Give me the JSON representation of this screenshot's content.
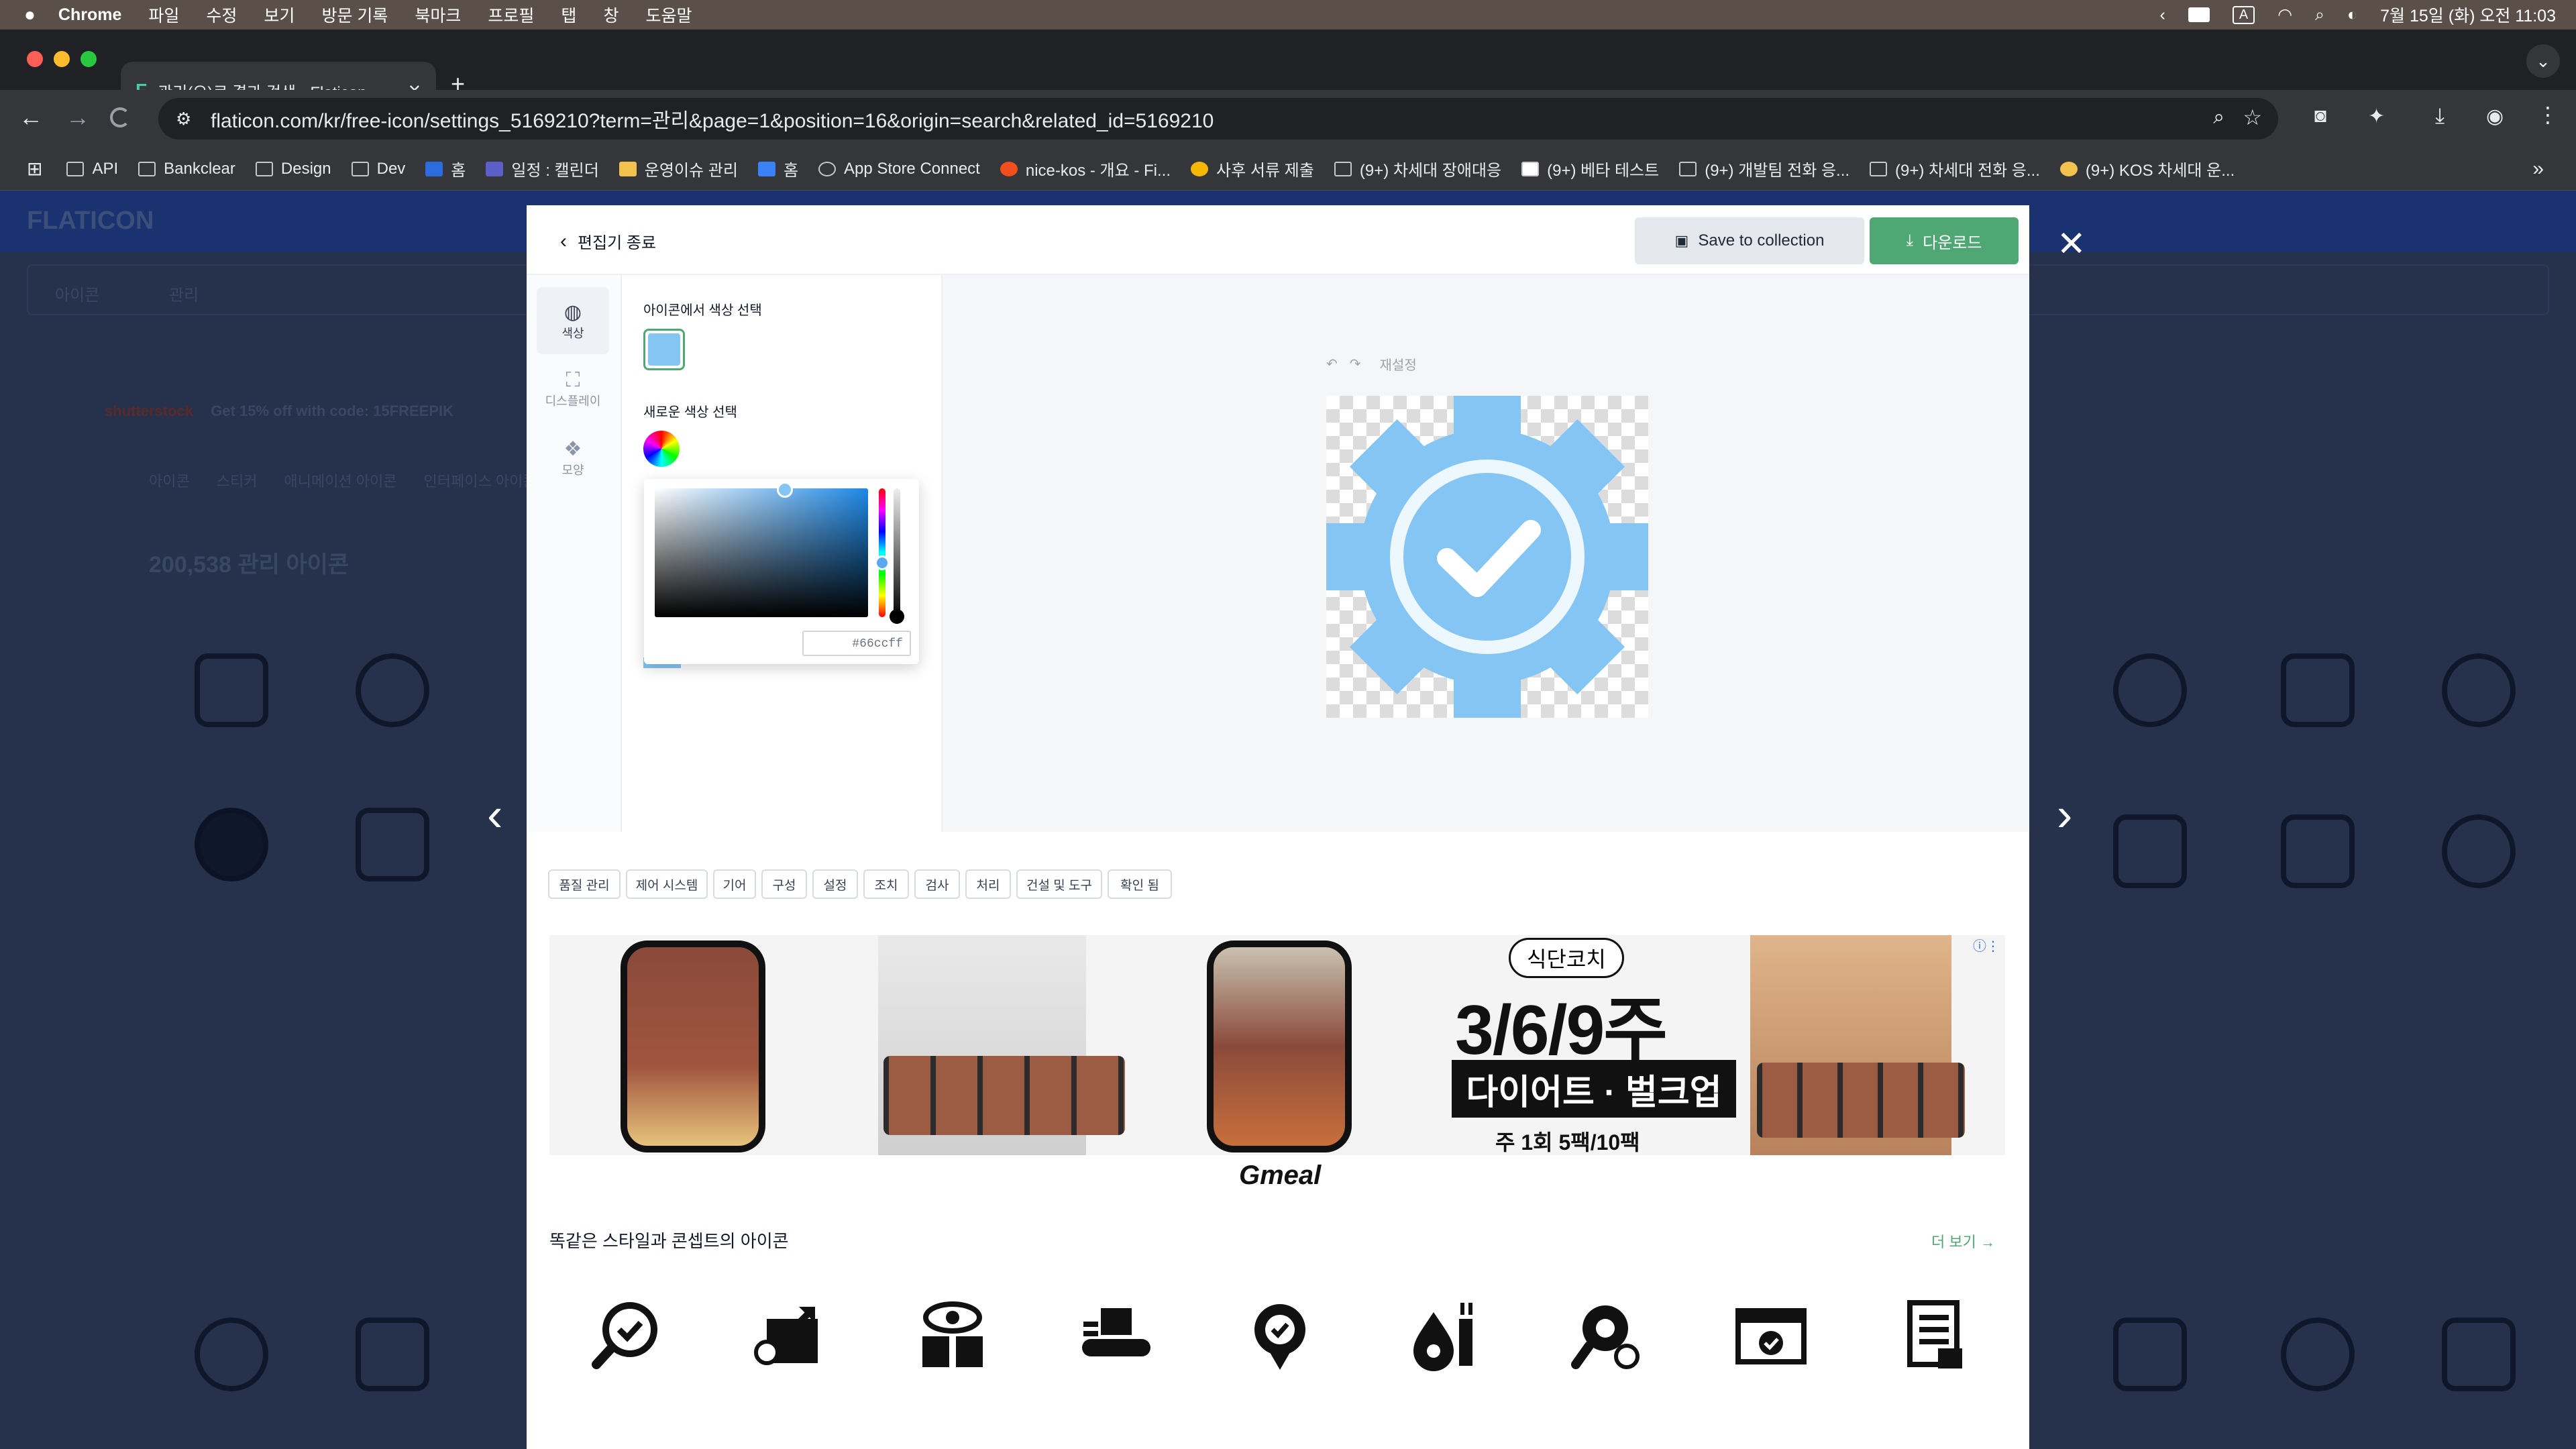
{
  "menubar": {
    "apple": "",
    "items": [
      "Chrome",
      "파일",
      "수정",
      "보기",
      "방문 기록",
      "북마크",
      "프로필",
      "탭",
      "창",
      "도움말"
    ],
    "right": {
      "input_badge": "A",
      "datetime": "7월 15일 (화) 오전 11:03"
    }
  },
  "browser": {
    "tab_title": "관리(으)로 결과 검색 - Flaticon",
    "new_tab": "+",
    "url": "flaticon.com/kr/free-icon/settings_5169210?term=관리&page=1&position=16&origin=search&related_id=5169210",
    "bookmarks": [
      "API",
      "Bankclear",
      "Design",
      "Dev",
      "홈",
      "일정 : 캘린더",
      "운영이슈 관리",
      "홈",
      "App Store Connect",
      "nice-kos - 개요 - Fi...",
      "사후 서류 제출",
      "(9+) 차세대 장애대응",
      "(9+) 베타 테스트",
      "(9+) 개발팀 전화 응...",
      "(9+) 차세대 전화 응...",
      "(9+) KOS 차세대 운..."
    ],
    "bookmarks_more": "»"
  },
  "background_page": {
    "logo": "FLATICON",
    "search_prefix": "아이콘",
    "search_term": "관리",
    "promo": "Get 15% off with code: 15FREEPIK",
    "promo_brand": "shutterstock",
    "tabs": [
      "아이콘",
      "스티커",
      "애니메이션 아이콘",
      "인터페이스 아이콘"
    ],
    "result_count": "200,538 관리 아이콘"
  },
  "modal": {
    "back_label": "편집기 종료",
    "save_label": "Save to collection",
    "download_label": "다운로드",
    "close": "✕",
    "side_tabs": [
      "색상",
      "디스플레이",
      "모양"
    ],
    "color_from_icon_label": "아이콘에서 색상 선택",
    "new_color_label": "새로운 색상 선택",
    "hex_value": "#66ccff",
    "reset_label": "재설정",
    "tags": [
      "품질 관리",
      "제어 시스템",
      "기어",
      "구성",
      "설정",
      "조치",
      "검사",
      "처리",
      "건설 및 도구",
      "확인 됨"
    ],
    "ad": {
      "badge": "식단코치",
      "headline": "3/6/9주",
      "banner": "다이어트 · 벌크업",
      "sub": "주 1회 5팩/10팩",
      "brand": "Gmeal"
    },
    "similar_title": "똑같은 스타일과 콘셉트의 아이콘",
    "more_label": "더 보기 →",
    "similar_icons": [
      "magnifier-check-icon",
      "box-arrow-icon",
      "eye-boxes-icon",
      "conveyor-icon",
      "badge-check-icon",
      "oil-drop-icon",
      "search-gear-icon",
      "browser-check-icon",
      "document-list-icon"
    ]
  },
  "colors": {
    "icon_color": "#84c5f4",
    "download_green": "#4fa874",
    "overlay": "#26324b"
  },
  "nav": {
    "prev": "‹",
    "next": "›"
  }
}
